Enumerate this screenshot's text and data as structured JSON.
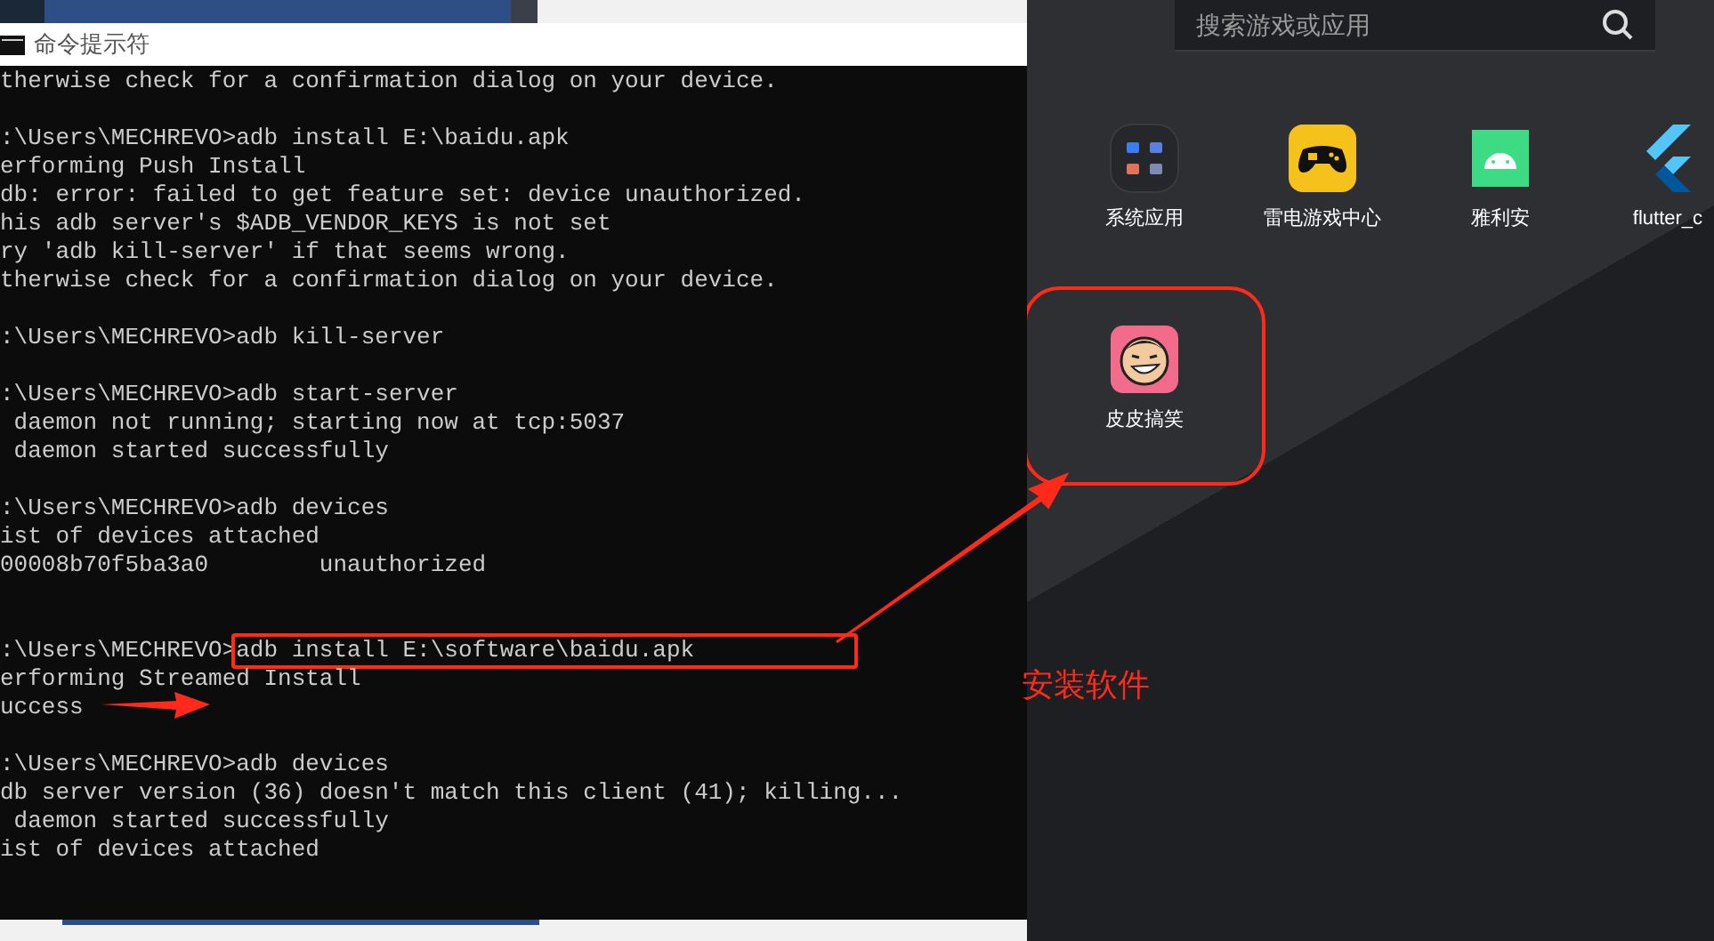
{
  "console_window": {
    "title": "命令提示符",
    "lines": [
      {
        "kind": "output",
        "text": "therwise check for a confirmation dialog on your device."
      },
      {
        "kind": "blank"
      },
      {
        "kind": "command",
        "prompt": ":\\Users\\MECHREVO>",
        "command": "adb install E:\\baidu.apk",
        "highlighted": false
      },
      {
        "kind": "output",
        "text": "erforming Push Install"
      },
      {
        "kind": "output",
        "text": "db: error: failed to get feature set: device unauthorized."
      },
      {
        "kind": "output",
        "text": "his adb server's $ADB_VENDOR_KEYS is not set"
      },
      {
        "kind": "output",
        "text": "ry 'adb kill-server' if that seems wrong."
      },
      {
        "kind": "output",
        "text": "therwise check for a confirmation dialog on your device."
      },
      {
        "kind": "blank"
      },
      {
        "kind": "command",
        "prompt": ":\\Users\\MECHREVO>",
        "command": "adb kill-server",
        "highlighted": false
      },
      {
        "kind": "blank"
      },
      {
        "kind": "command",
        "prompt": ":\\Users\\MECHREVO>",
        "command": "adb start-server",
        "highlighted": false
      },
      {
        "kind": "output",
        "text": " daemon not running; starting now at tcp:5037"
      },
      {
        "kind": "output",
        "text": " daemon started successfully"
      },
      {
        "kind": "blank"
      },
      {
        "kind": "command",
        "prompt": ":\\Users\\MECHREVO>",
        "command": "adb devices",
        "highlighted": false
      },
      {
        "kind": "output",
        "text": "ist of devices attached"
      },
      {
        "kind": "output",
        "text": "00008b70f5ba3a0        unauthorized"
      },
      {
        "kind": "blank"
      },
      {
        "kind": "blank"
      },
      {
        "kind": "command",
        "prompt": ":\\Users\\MECHREVO>",
        "command": "adb install E:\\software\\baidu.apk",
        "highlighted": true
      },
      {
        "kind": "output",
        "text": "erforming Streamed Install"
      },
      {
        "kind": "output",
        "text": "uccess"
      },
      {
        "kind": "blank"
      },
      {
        "kind": "command",
        "prompt": ":\\Users\\MECHREVO>",
        "command": "adb devices",
        "highlighted": false
      },
      {
        "kind": "output",
        "text": "db server version (36) doesn't match this client (41); killing..."
      },
      {
        "kind": "output",
        "text": " daemon started successfully"
      },
      {
        "kind": "output",
        "text": "ist of devices attached"
      }
    ]
  },
  "emulator": {
    "search": {
      "placeholder": "搜索游戏或应用"
    },
    "apps": [
      {
        "kind": "folder",
        "label": "系统应用",
        "highlighted": false
      },
      {
        "kind": "gamepad",
        "label": "雷电游戏中心",
        "highlighted": false
      },
      {
        "kind": "android",
        "label": "雅利安",
        "highlighted": false
      },
      {
        "kind": "flutter",
        "label": "flutter_c",
        "highlighted": false
      },
      {
        "kind": "cartoon",
        "label": "皮皮搞笑",
        "highlighted": true
      }
    ]
  },
  "annotation": {
    "text": "安装软件"
  }
}
